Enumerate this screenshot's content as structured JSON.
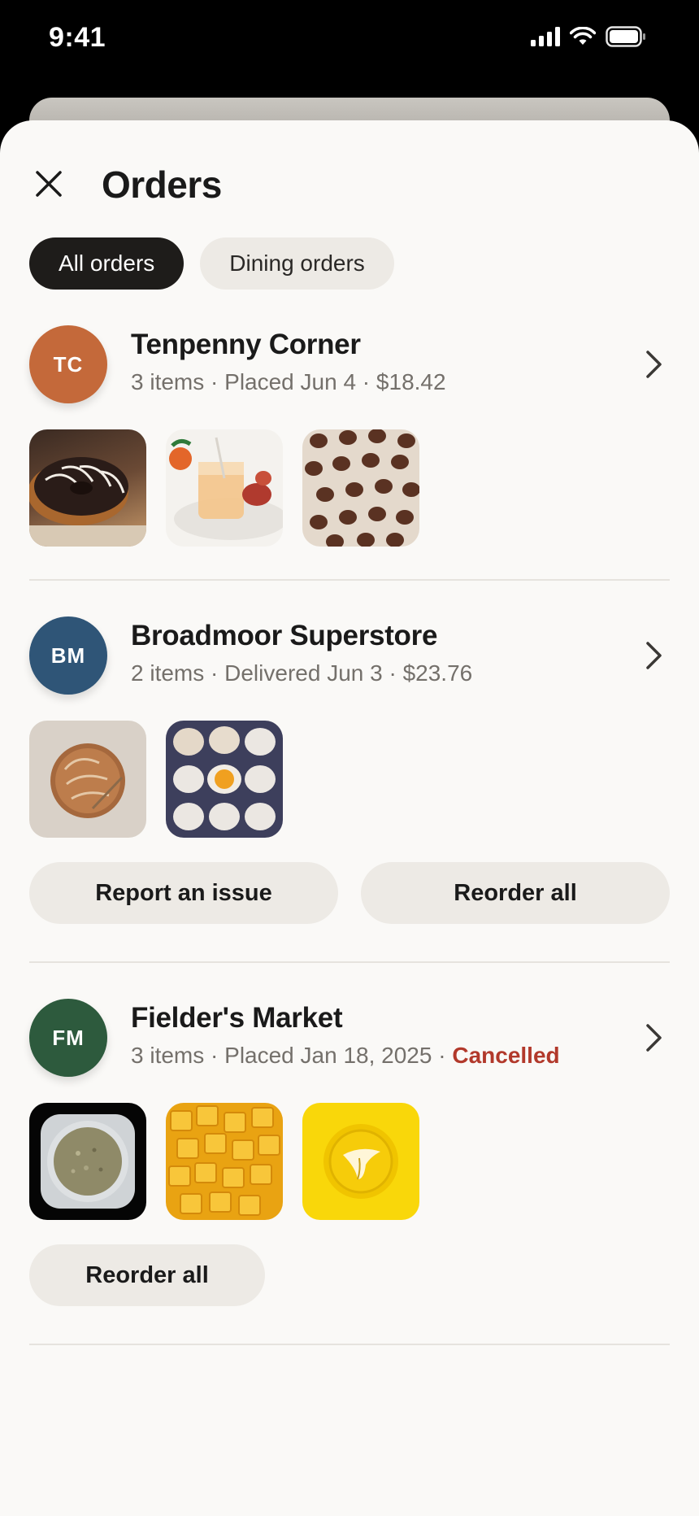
{
  "status_bar": {
    "time": "9:41"
  },
  "header": {
    "title": "Orders",
    "close_icon": "close-icon"
  },
  "tabs": [
    {
      "label": "All orders",
      "active": true
    },
    {
      "label": "Dining orders",
      "active": false
    }
  ],
  "orders": [
    {
      "initials": "TC",
      "avatar_color": "#c4693a",
      "name": "Tenpenny Corner",
      "items": "3 items",
      "status": "Placed Jun 4",
      "total": "$18.42",
      "thumbnails": [
        "chocolate-donuts",
        "citrus-drink",
        "chocolate-box"
      ]
    },
    {
      "initials": "BM",
      "avatar_color": "#2f5577",
      "name": "Broadmoor Superstore",
      "items": "2 items",
      "status": "Delivered Jun 3",
      "total": "$23.76",
      "thumbnails": [
        "bread-board",
        "egg-carton"
      ],
      "actions": {
        "report": "Report an issue",
        "reorder": "Reorder all"
      }
    },
    {
      "initials": "FM",
      "avatar_color": "#2d5a3d",
      "name": "Fielder's Market",
      "items": "3 items",
      "status": "Placed Jan 18, 2025",
      "cancelled_label": "Cancelled",
      "thumbnails": [
        "spice-jar",
        "mango-cubes",
        "banana-coin"
      ],
      "actions": {
        "reorder": "Reorder all"
      }
    }
  ],
  "separator": " · ",
  "colors": {
    "cancelled": "#b2392b",
    "active_tab": "#1e1c1a",
    "pill": "#edeae5"
  }
}
